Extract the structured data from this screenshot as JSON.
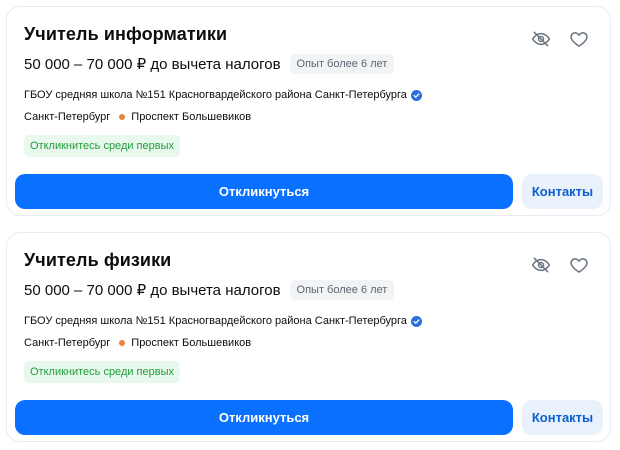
{
  "colors": {
    "primary": "#0a70ff",
    "contacts_bg": "#e9f2fb",
    "contacts_text": "#0a5fd6",
    "badge_green_bg": "#e9f8ec",
    "badge_green_text": "#1f9d3b",
    "metro_dot": "#e8843c",
    "verified": "#2b6fe0"
  },
  "icons": {
    "hide": "eye-off-icon",
    "favorite": "heart-icon",
    "verified": "verified-check-icon",
    "metro": "metro-dot-icon"
  },
  "vacancies": [
    {
      "title": "Учитель информатики",
      "salary": "50 000 – 70 000 ₽ до вычета налогов",
      "experience": "Опыт более 6 лет",
      "employer": "ГБОУ средняя школа №151 Красногвардейского района Санкт-Петербурга",
      "city": "Санкт-Петербург",
      "metro": "Проспект Большевиков",
      "badge": "Откликнитесь среди первых",
      "respond_label": "Откликнуться",
      "contacts_label": "Контакты"
    },
    {
      "title": "Учитель физики",
      "salary": "50 000 – 70 000 ₽ до вычета налогов",
      "experience": "Опыт более 6 лет",
      "employer": "ГБОУ средняя школа №151 Красногвардейского района Санкт-Петербурга",
      "city": "Санкт-Петербург",
      "metro": "Проспект Большевиков",
      "badge": "Откликнитесь среди первых",
      "respond_label": "Откликнуться",
      "contacts_label": "Контакты"
    }
  ]
}
